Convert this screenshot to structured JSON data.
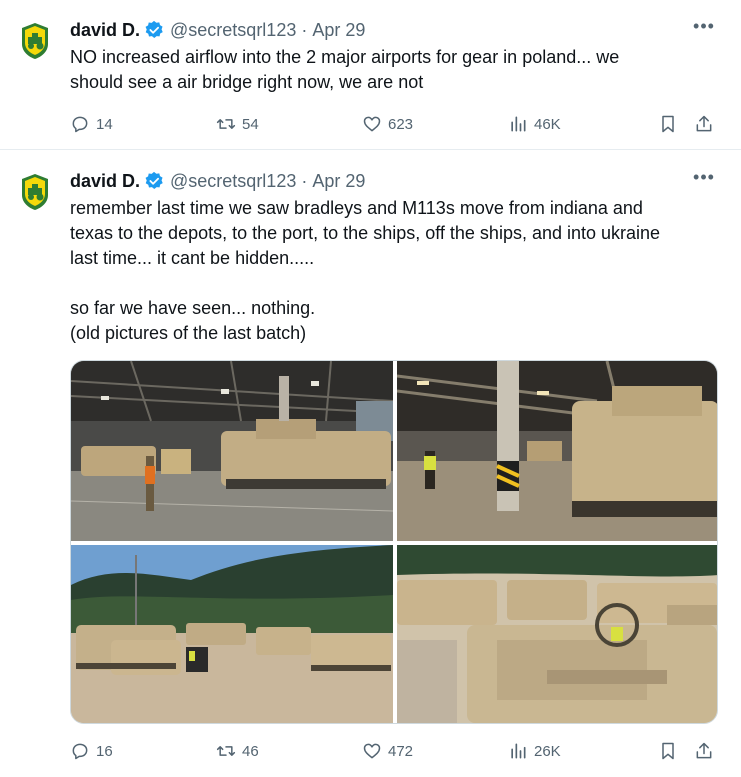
{
  "tweets": [
    {
      "author_name": "david D.",
      "handle": "@secretsqrl123",
      "separator": "·",
      "date": "Apr 29",
      "more_icon": "more-horizontal-icon",
      "text": "NO increased airflow into the 2 major airports for gear in poland... we\nshould see a air bridge right now, we are not",
      "replies": "14",
      "retweets": "54",
      "likes": "623",
      "views": "46K"
    },
    {
      "author_name": "david D.",
      "handle": "@secretsqrl123",
      "separator": "·",
      "date": "Apr 29",
      "more_icon": "more-horizontal-icon",
      "text": "remember last time we saw bradleys and M113s move from indiana and\ntexas to the depots, to the port, to the ships, off the ships, and into ukraine\nlast time... it cant be hidden.....\n\nso far we have seen... nothing.\n(old pictures of the last batch)",
      "replies": "16",
      "retweets": "46",
      "likes": "472",
      "views": "26K",
      "media": [
        {
          "scene": "bradleys-inside-ship-hold"
        },
        {
          "scene": "bradleys-in-ship-deck-worker"
        },
        {
          "scene": "vehicles-parked-forest-lot"
        },
        {
          "scene": "vehicles-in-rows-aerial"
        }
      ]
    }
  ],
  "colors": {
    "text": "#0f1419",
    "muted": "#536471",
    "verified": "#1d9bf0",
    "avatar_green": "#2f7d32",
    "avatar_yellow": "#f5d90a"
  }
}
